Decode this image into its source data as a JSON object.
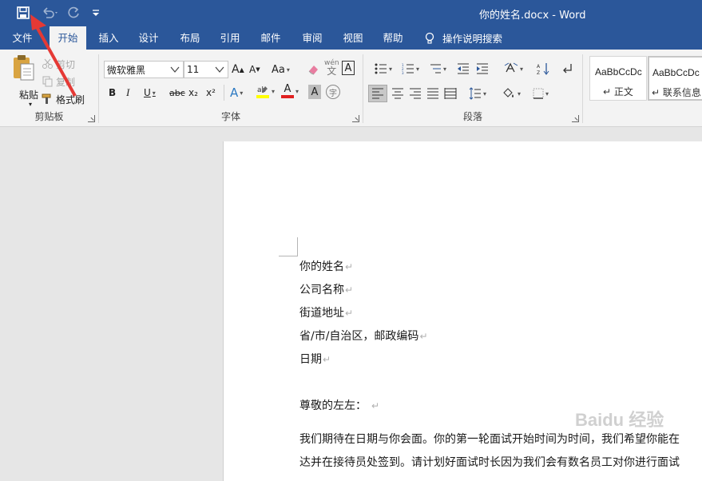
{
  "title_bar": {
    "document_title": "你的姓名.docx  -  Word",
    "quick_access": {
      "save_icon": "save-icon",
      "undo_icon": "undo-icon",
      "redo_icon": "redo-icon",
      "customize_icon": "customize-qat-icon"
    }
  },
  "tabs": [
    {
      "label": "文件",
      "active": false
    },
    {
      "label": "开始",
      "active": true
    },
    {
      "label": "插入",
      "active": false
    },
    {
      "label": "设计",
      "active": false
    },
    {
      "label": "布局",
      "active": false
    },
    {
      "label": "引用",
      "active": false
    },
    {
      "label": "邮件",
      "active": false
    },
    {
      "label": "审阅",
      "active": false
    },
    {
      "label": "视图",
      "active": false
    },
    {
      "label": "帮助",
      "active": false
    }
  ],
  "tell_me": {
    "label": "操作说明搜索",
    "icon": "lightbulb-icon"
  },
  "ribbon": {
    "clipboard": {
      "group_label": "剪贴板",
      "paste": "粘贴",
      "cut": "剪切",
      "copy": "复制",
      "format_painter": "格式刷"
    },
    "font": {
      "group_label": "字体",
      "font_name": "微软雅黑",
      "font_size": "11",
      "change_case": "Aa",
      "bold": "B",
      "italic": "I",
      "underline": "U",
      "strikethrough": "abc",
      "subscript": "x₂",
      "superscript": "x²",
      "grow_font": "A",
      "shrink_font": "A",
      "clear_format": "A",
      "phonetic": "wén",
      "char_border": "A",
      "font_color": "A",
      "char_shading": "A",
      "enclose": "字"
    },
    "paragraph": {
      "group_label": "段落"
    },
    "styles": [
      {
        "sample": "AaBbCcDc",
        "name": "正文"
      },
      {
        "sample": "AaBbCcDc",
        "name": "联系信息"
      }
    ]
  },
  "colors": {
    "brand": "#2b579a",
    "highlight": "#ffff00",
    "font_color": "#e02020",
    "annotation": "#e53935"
  },
  "document": {
    "lines": [
      "你的姓名",
      "公司名称",
      "街道地址",
      "省/市/自治区，邮政编码",
      "日期",
      "尊敬的左左：",
      "我们期待在日期与你会面。你的第一轮面试开始时间为时间，我们希望你能在",
      "达并在接待员处签到。请计划好面试时长因为我们会有数名员工对你进行面试"
    ],
    "paragraph_mark": "↵"
  },
  "watermark": "Baidu 经验"
}
